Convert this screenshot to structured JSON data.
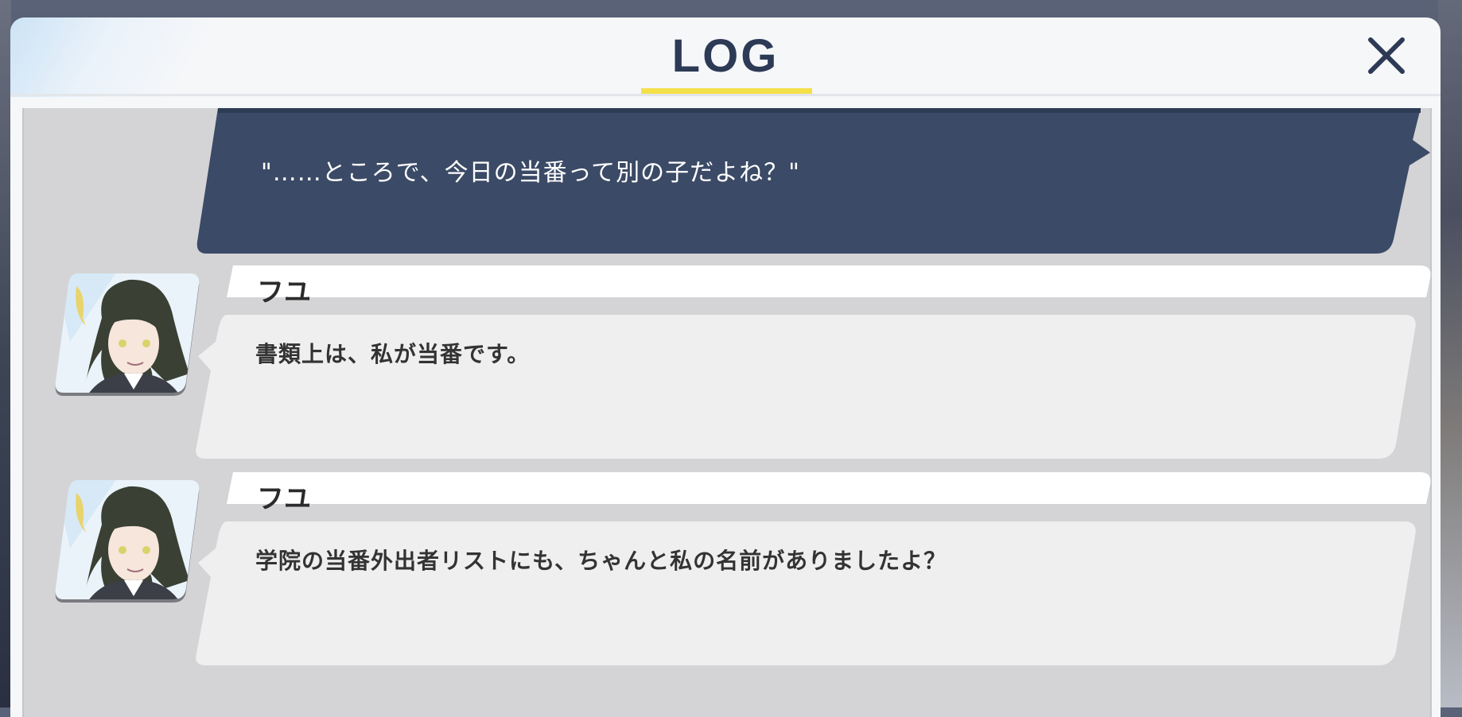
{
  "header": {
    "title": "LOG"
  },
  "log": {
    "player_line": "\"……ところで、今日の当番って別の子だよね？\"",
    "entries": [
      {
        "speaker": "フユ",
        "text": "書類上は、私が当番です。"
      },
      {
        "speaker": "フユ",
        "text": "学院の当番外出者リストにも、ちゃんと私の名前がありましたよ？"
      }
    ]
  },
  "colors": {
    "title": "#2d3a55",
    "accent_underline": "#f4e04a",
    "player_bubble": "#3b4a66",
    "log_background": "#d4d4d6",
    "npc_bubble": "#efefef"
  },
  "icons": {
    "close": "close-icon",
    "portrait": "character-portrait"
  }
}
